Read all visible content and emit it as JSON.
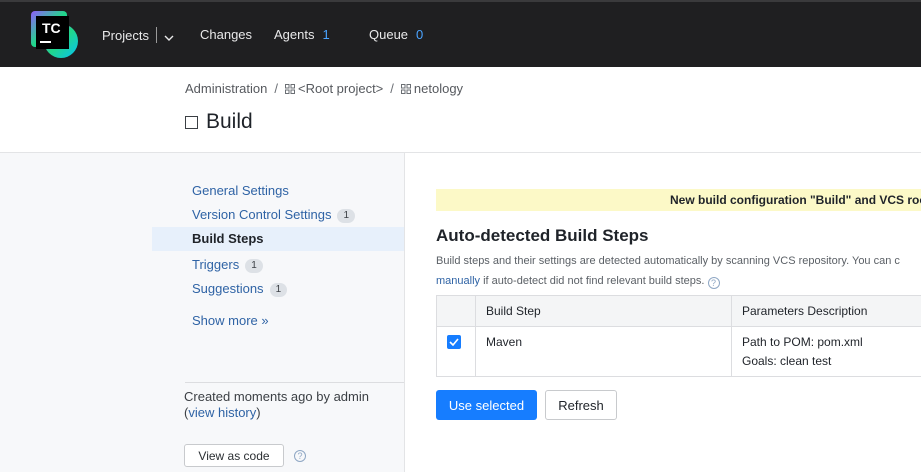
{
  "header": {
    "logo_text": "TC",
    "projects_label": "Projects",
    "changes_label": "Changes",
    "agents_label": "Agents",
    "agents_count": "1",
    "queue_label": "Queue",
    "queue_count": "0"
  },
  "breadcrumb": {
    "items": [
      "Administration",
      "<Root project>",
      "netology"
    ],
    "separator": "/"
  },
  "page_title": "Build",
  "sidebar": {
    "items": [
      {
        "label": "General Settings",
        "badge": ""
      },
      {
        "label": "Version Control Settings",
        "badge": "1"
      },
      {
        "label": "Build Steps",
        "badge": ""
      },
      {
        "label": "Triggers",
        "badge": "1"
      },
      {
        "label": "Suggestions",
        "badge": "1"
      }
    ],
    "active": "Build Steps",
    "show_more": "Show more »",
    "created_text": "Created moments ago by admin",
    "view_history_open": "(",
    "view_history": "view history",
    "view_history_close": ")",
    "view_as_code": "View as code"
  },
  "main": {
    "notice": "New build configuration \"Build\" and VCS root",
    "section_title": "Auto-detected Build Steps",
    "desc_line1": "Build steps and their settings are detected automatically by scanning VCS repository. You can c",
    "desc_link": "manually",
    "desc_line2_rest": " if auto-detect did not find relevant build steps.",
    "table": {
      "headers": [
        "Build Step",
        "Parameters Description"
      ],
      "rows": [
        {
          "checked": true,
          "step": "Maven",
          "params": [
            "Path to POM: pom.xml",
            "Goals: clean test"
          ]
        }
      ]
    },
    "use_selected": "Use selected",
    "refresh": "Refresh"
  },
  "colors": {
    "topbar": "#1f1f21",
    "accent": "#167dff",
    "link": "#2f63a5",
    "notice_bg": "#fcf9c7"
  }
}
